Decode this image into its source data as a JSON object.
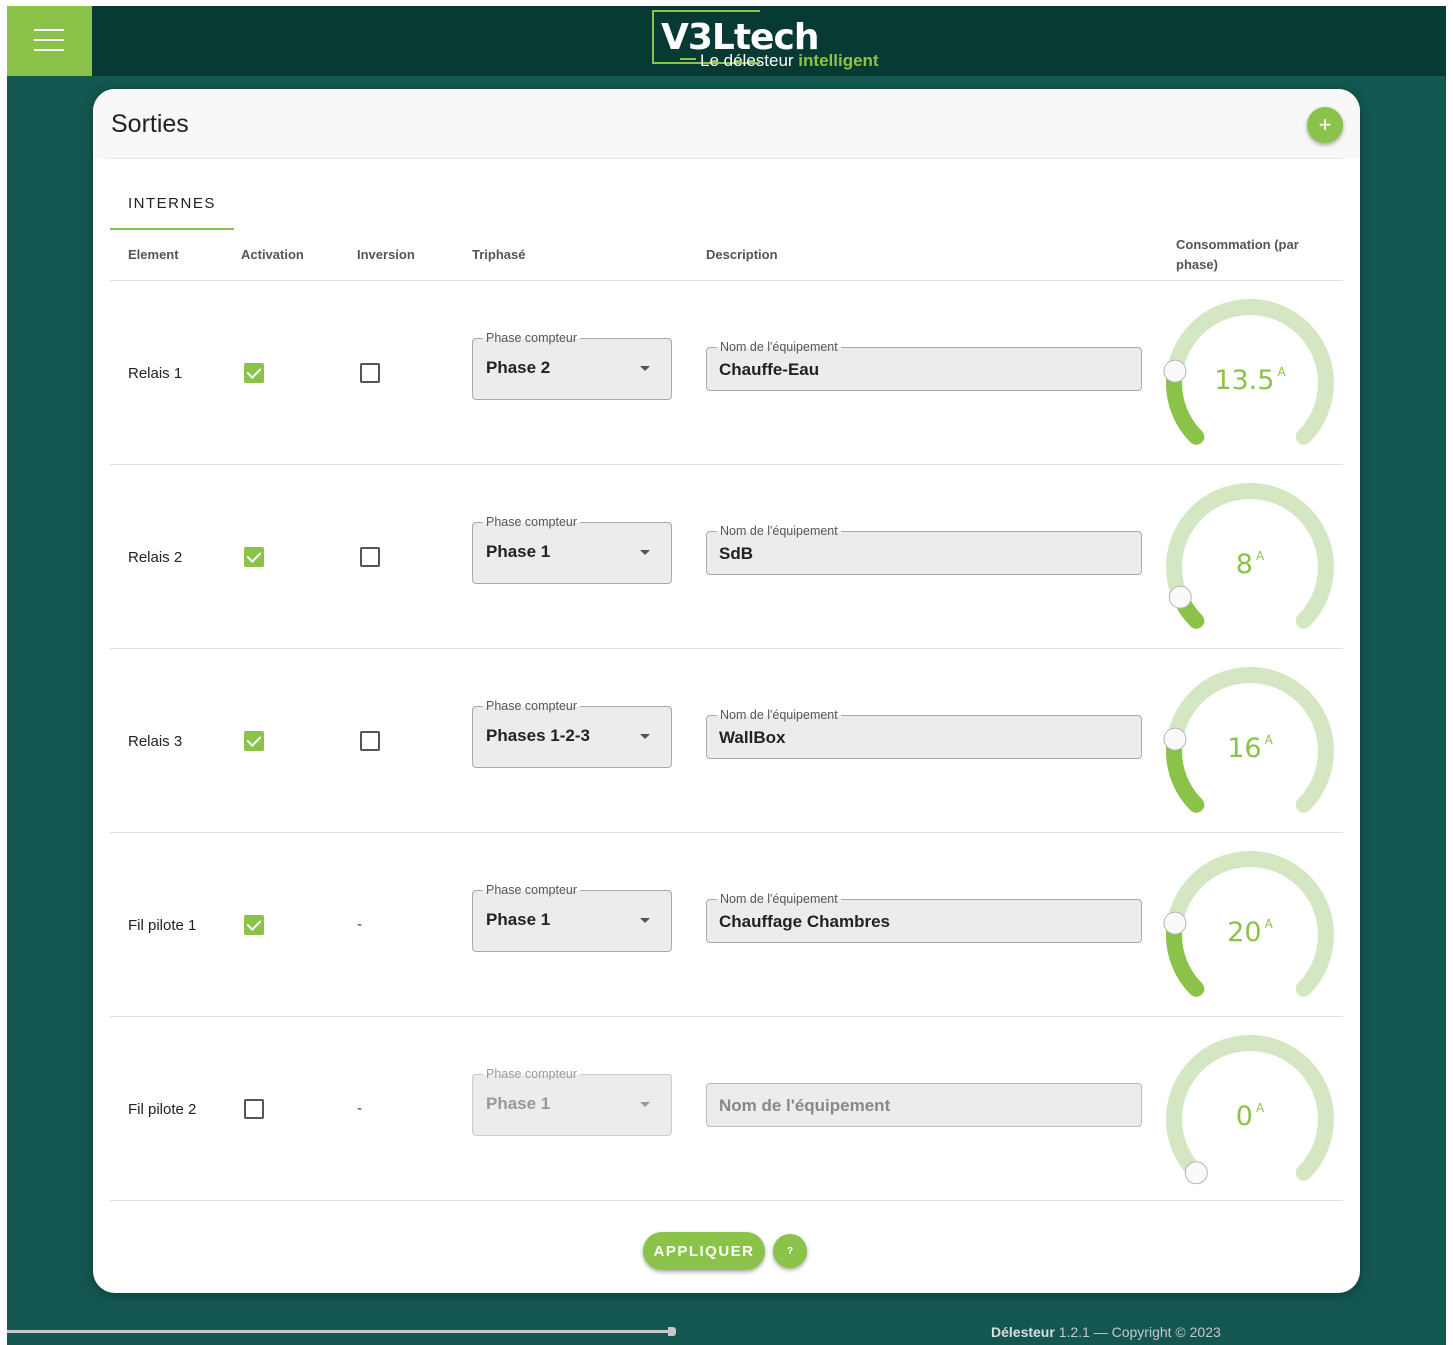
{
  "brand": {
    "logo_main": "V3Ltech",
    "logo_sub_plain": "Le délesteur ",
    "logo_sub_accent": "intelligent",
    "accent_color": "#8bc34a",
    "header_color": "#073a33",
    "background_color": "#135750"
  },
  "card": {
    "title": "Sorties",
    "add_button": "+",
    "tab": "INTERNES"
  },
  "columns": {
    "element": "Element",
    "activation": "Activation",
    "inversion": "Inversion",
    "triphase": "Triphasé",
    "description": "Description",
    "consommation": "Consommation (par phase)"
  },
  "rows": [
    {
      "element": "Relais 1",
      "activation": true,
      "inversion": false,
      "inversion_text": "",
      "phase_label": "Phase compteur",
      "phase": "Phase 2",
      "desc_label": "Nom de l'équipement",
      "description": "Chauffe-Eau",
      "consumption": "13.5",
      "unit": "A",
      "gauge_fraction": 0.2,
      "disabled": false
    },
    {
      "element": "Relais 2",
      "activation": true,
      "inversion": false,
      "inversion_text": "",
      "phase_label": "Phase compteur",
      "phase": "Phase 1",
      "desc_label": "Nom de l'équipement",
      "description": "SdB",
      "consumption": "8",
      "unit": "A",
      "gauge_fraction": 0.08,
      "disabled": false
    },
    {
      "element": "Relais 3",
      "activation": true,
      "inversion": false,
      "inversion_text": "",
      "phase_label": "Phase compteur",
      "phase": "Phases 1-2-3",
      "desc_label": "Nom de l'équipement",
      "description": "WallBox",
      "consumption": "16",
      "unit": "A",
      "gauge_fraction": 0.2,
      "disabled": false
    },
    {
      "element": "Fil pilote 1",
      "activation": true,
      "inversion": null,
      "inversion_text": "-",
      "phase_label": "Phase compteur",
      "phase": "Phase 1",
      "desc_label": "Nom de l'équipement",
      "description": "Chauffage Chambres",
      "consumption": "20",
      "unit": "A",
      "gauge_fraction": 0.2,
      "disabled": false
    },
    {
      "element": "Fil pilote 2",
      "activation": false,
      "inversion": null,
      "inversion_text": "-",
      "phase_label": "Phase compteur",
      "phase": "Phase 1",
      "desc_label": "",
      "description": "",
      "desc_placeholder": "Nom de l'équipement",
      "consumption": "0",
      "unit": "A",
      "gauge_fraction": 0,
      "disabled": true
    }
  ],
  "actions": {
    "apply": "APPLIQUER",
    "help": "?"
  },
  "footer": {
    "app_name": "Délesteur",
    "version_copyright": " 1.2.1 — Copyright © 2023"
  },
  "icons": [
    "menu-icon",
    "add-icon",
    "check-icon",
    "caret-down-icon",
    "help-icon",
    "plug-icon"
  ]
}
